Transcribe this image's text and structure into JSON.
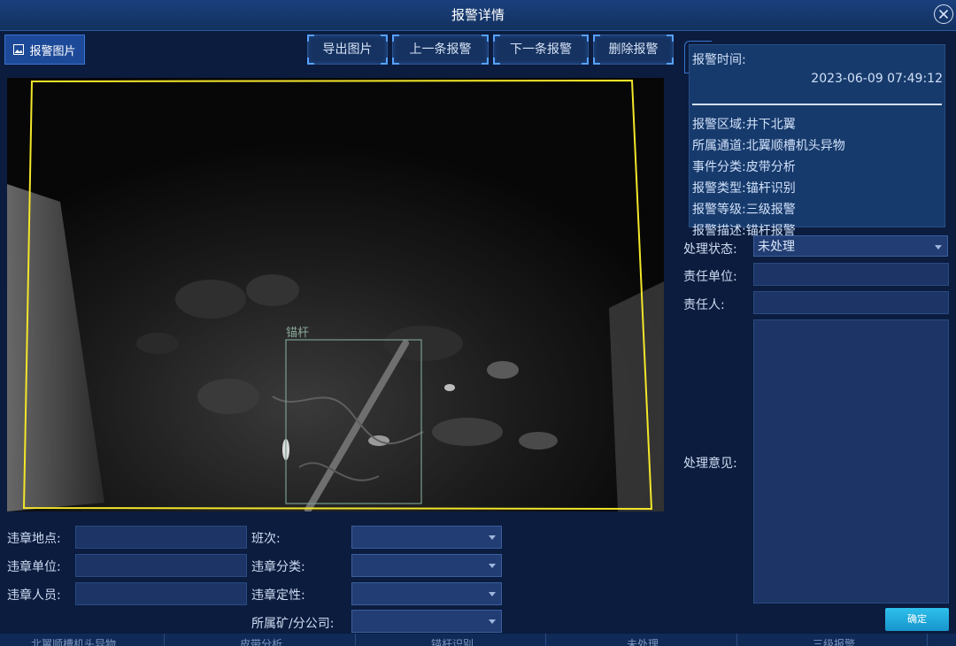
{
  "window": {
    "title": "报警详情"
  },
  "toolbar": {
    "tab_alarm_image": "报警图片",
    "export_image": "导出图片",
    "prev_alarm": "上一条报警",
    "next_alarm": "下一条报警",
    "delete_alarm": "删除报警"
  },
  "camera": {
    "detection_label": "锚杆"
  },
  "info": {
    "alarm_time_label": "报警时间:",
    "alarm_time_value": "2023-06-09 07:49:12",
    "rows": [
      {
        "label": "报警区域:",
        "value": "井下北翼"
      },
      {
        "label": "所属通道:",
        "value": "北翼顺槽机头异物"
      },
      {
        "label": "事件分类:",
        "value": "皮带分析"
      },
      {
        "label": "报警类型:",
        "value": "锚杆识别"
      },
      {
        "label": "报警等级:",
        "value": "三级报警"
      },
      {
        "label": "报警描述:",
        "value": "锚杆报警"
      }
    ]
  },
  "handling": {
    "status_label": "处理状态:",
    "status_value": "未处理",
    "unit_label": "责任单位:",
    "unit_value": "",
    "person_label": "责任人:",
    "person_value": "",
    "opinion_label": "处理意见:",
    "ok_button": "确定"
  },
  "violation": {
    "place_label": "违章地点:",
    "unit_label": "违章单位:",
    "person_label": "违章人员:",
    "shift_label": "班次:",
    "category_label": "违章分类:",
    "nature_label": "违章定性:",
    "company_label": "所属矿/分公司:"
  },
  "footer_row": [
    "北翼顺槽机头异物",
    "皮带分析",
    "锚杆识别",
    "未处理",
    "三级报警"
  ],
  "colors": {
    "title_bar": "#12315f",
    "background": "#0b1c3e",
    "roi_outline": "#f2e62a",
    "detection_box": "#7a9e8c",
    "confirm_button": "#2fc0ec"
  }
}
